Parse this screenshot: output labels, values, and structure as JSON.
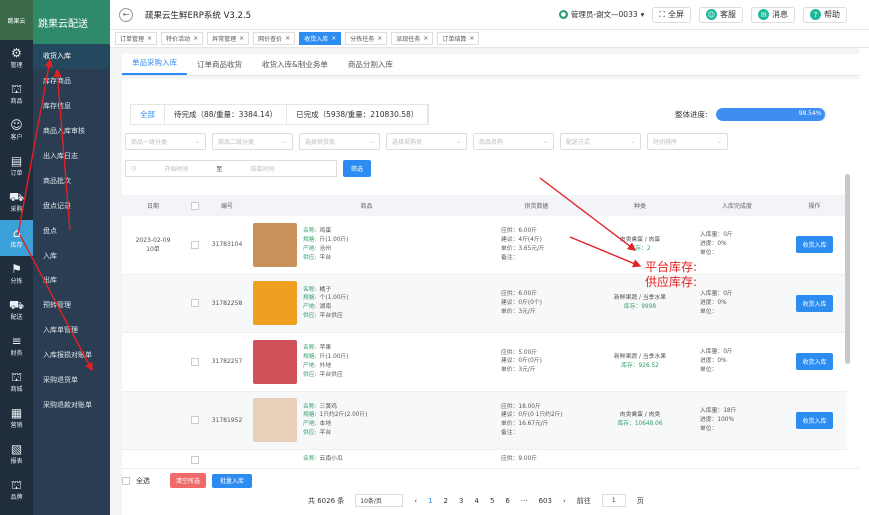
{
  "brand": {
    "logo": "跳果云",
    "name": "跳果云配送"
  },
  "left_nav": [
    {
      "icon": "⚙",
      "label": "管理"
    },
    {
      "icon": "⛫",
      "label": "商品"
    },
    {
      "icon": "☺",
      "label": "客户"
    },
    {
      "icon": "▤",
      "label": "订单"
    },
    {
      "icon": "⛟",
      "label": "采购"
    },
    {
      "icon": "⌂",
      "label": "库存",
      "active": true
    },
    {
      "icon": "⚑",
      "label": "分拣"
    },
    {
      "icon": "⛟",
      "label": "配送"
    },
    {
      "icon": "≡",
      "label": "财务"
    },
    {
      "icon": "⛫",
      "label": "商城"
    },
    {
      "icon": "▦",
      "label": "营销"
    },
    {
      "icon": "▧",
      "label": "报表"
    },
    {
      "icon": "⛫",
      "label": "品牌"
    }
  ],
  "sub_nav": [
    "收货入库",
    "库存商品",
    "库存信息",
    "商品入库审核",
    "出入库日志",
    "商品批次",
    "盘点记录",
    "盘点",
    "入库",
    "出库",
    "预转管理",
    "入库单管理",
    "入库报损对账单",
    "采购退货单",
    "采购退款对账单"
  ],
  "topbar": {
    "title": "疏果云生鲜ERP系统  V3.2.5",
    "user": "管理员-谢文—0033",
    "fullscreen": "全屏",
    "service": "客服",
    "messages": "消息",
    "help": "帮助"
  },
  "page_tabs": [
    "订单管理",
    "特价活动",
    "异常管理",
    "网价查价",
    "收货入库",
    "分拣任务",
    "派现任务",
    "订单结算"
  ],
  "sub_tabs": [
    "单品采购入库",
    "订单商品收货",
    "收货入库&制业务单",
    "商品分割入库"
  ],
  "status_tabs": [
    "全部",
    "待完成（88/重量：3384.14）",
    "已完成（5938/重量：210830.58）"
  ],
  "overall": {
    "label": "整体进度:",
    "percent_text": "98.54%",
    "fraction": 0.9854
  },
  "filters": [
    "商品一级分类",
    "商品二级分类",
    "选择供货商",
    "选择采购员",
    "商品名称",
    "配送方式",
    "时间排序"
  ],
  "date": {
    "start": "开始时间",
    "sep": "至",
    "end": "结束时间",
    "button": "筛选"
  },
  "table": {
    "headers": [
      "日期",
      "",
      "编号",
      "商品",
      "供货数据",
      "种类",
      "入库完成度",
      "操作"
    ],
    "rows": [
      {
        "date": "2023-02-09",
        "count": "10单",
        "no": "31783104",
        "name": "鸡蛋",
        "spec": "斤(1.00斤)",
        "origin": "沧州",
        "supplier": "平台",
        "s1": "应供：6.00斤",
        "s2": "建议：4斤(4斤)",
        "s3": "单价：3.65元/斤",
        "s4": "备注：",
        "kind": "肉类禽蛋 / 肉蛋",
        "stock": "库存：2",
        "in": "入库量：0斤",
        "rate": "进度：0%",
        "unit": "单位：",
        "op": "收货入库",
        "img": "#c9925a"
      },
      {
        "date": "",
        "count": "",
        "no": "31782258",
        "name": "橘子",
        "spec": "个(1.00斤)",
        "origin": "湖南",
        "supplier": "平台供应",
        "s1": "应供：6.00斤",
        "s2": "建议：0斤(0个)",
        "s3": "单价：3元/斤",
        "s4": "",
        "kind": "新鲜果蔬 / 当季水果",
        "stock": "库存：9998",
        "in": "入库量：0斤",
        "rate": "进度：0%",
        "unit": "单位：",
        "op": "收货入库",
        "img": "#f0a020"
      },
      {
        "date": "",
        "count": "",
        "no": "31782257",
        "name": "苹果",
        "spec": "斤(1.00斤)",
        "origin": "外地",
        "supplier": "平台供应",
        "s1": "应供：5.00斤",
        "s2": "建议：0斤(0斤)",
        "s3": "单价：3元/斤",
        "s4": "",
        "kind": "新鲜果蔬 / 当季水果",
        "stock": "库存：926.52",
        "in": "入库量：0斤",
        "rate": "进度：0%",
        "unit": "单位：",
        "op": "收货入库",
        "img": "#d0505a"
      },
      {
        "date": "",
        "count": "",
        "no": "31781952",
        "name": "三黄鸡",
        "spec": "1只约2斤(2.00斤)",
        "origin": "本地",
        "supplier": "平台",
        "s1": "应供：18.00斤",
        "s2": "建议：0斤(0 1只约2斤)",
        "s3": "单价：16.67元/斤",
        "s4": "备注：",
        "kind": "肉类禽蛋 / 肉类",
        "stock": "库存：10648.06",
        "in": "入库量：18斤",
        "rate": "进度：100%",
        "unit": "单位：",
        "op": "收货入库",
        "img": "#e8d0b8"
      },
      {
        "date": "",
        "count": "",
        "no": "",
        "name": "云南小瓜",
        "spec": "",
        "origin": "",
        "supplier": "",
        "s1": "应供：9.00斤",
        "s2": "",
        "s3": "",
        "s4": "",
        "kind": "",
        "stock": "",
        "in": "",
        "rate": "",
        "unit": "",
        "op": "",
        "img": ""
      }
    ],
    "field_labels": {
      "name": "名称:",
      "spec": "规格:",
      "origin": "产地:",
      "supplier": "供应:"
    }
  },
  "footer": {
    "select_all": "全选",
    "clear": "清空所选",
    "batch": "批量入库",
    "total": "共 6026 条",
    "page_size": "10条/页",
    "pages": [
      "1",
      "2",
      "3",
      "4",
      "5",
      "6",
      "···",
      "603"
    ],
    "goto": "前往",
    "goto_page": "1",
    "page_unit": "页"
  },
  "annotation": {
    "line1": "平台库存:",
    "line2": "供应库存:"
  },
  "colors": {
    "primary": "#2d8cf0",
    "nav_bg": "#1f2d3d",
    "active_nav": "#3aa0d8",
    "annotation": "#e42020"
  }
}
